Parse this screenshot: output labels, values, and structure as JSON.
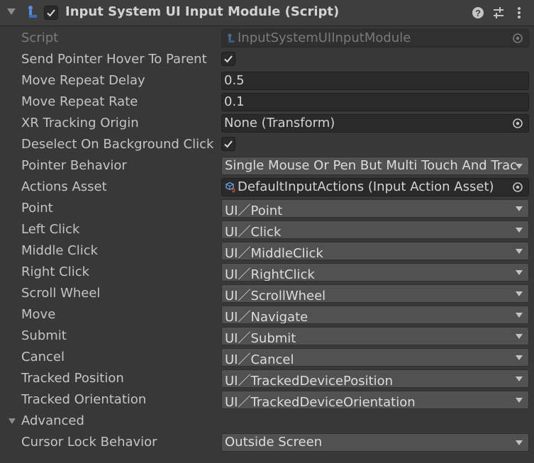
{
  "header": {
    "title": "Input System UI Input Module (Script)",
    "enabled": true,
    "icons": [
      "foldout-arrow-icon",
      "script-icon",
      "help-icon",
      "presets-icon",
      "more-options-icon"
    ]
  },
  "fields": {
    "script": {
      "label": "Script",
      "value": "InputSystemUIInputModule"
    },
    "send_pointer_hover": {
      "label": "Send Pointer Hover To Parent",
      "checked": true
    },
    "move_repeat_delay": {
      "label": "Move Repeat Delay",
      "value": "0.5"
    },
    "move_repeat_rate": {
      "label": "Move Repeat Rate",
      "value": "0.1"
    },
    "xr_tracking_origin": {
      "label": "XR Tracking Origin",
      "value": "None (Transform)"
    },
    "deselect_on_background_click": {
      "label": "Deselect On Background Click",
      "checked": true
    },
    "pointer_behavior": {
      "label": "Pointer Behavior",
      "value": "Single Mouse Or Pen But Multi Touch And Track"
    },
    "actions_asset": {
      "label": "Actions Asset",
      "value": "DefaultInputActions (Input Action Asset)"
    },
    "point": {
      "label": "Point",
      "value": "UI／Point"
    },
    "left_click": {
      "label": "Left Click",
      "value": "UI／Click"
    },
    "middle_click": {
      "label": "Middle Click",
      "value": "UI／MiddleClick"
    },
    "right_click": {
      "label": "Right Click",
      "value": "UI／RightClick"
    },
    "scroll_wheel": {
      "label": "Scroll Wheel",
      "value": "UI／ScrollWheel"
    },
    "move": {
      "label": "Move",
      "value": "UI／Navigate"
    },
    "submit": {
      "label": "Submit",
      "value": "UI／Submit"
    },
    "cancel": {
      "label": "Cancel",
      "value": "UI／Cancel"
    },
    "tracked_position": {
      "label": "Tracked Position",
      "value": "UI／TrackedDevicePosition"
    },
    "tracked_orientation": {
      "label": "Tracked Orientation",
      "value": "UI／TrackedDeviceOrientation"
    }
  },
  "advanced": {
    "label": "Advanced",
    "expanded": true,
    "cursor_lock_behavior": {
      "label": "Cursor Lock Behavior",
      "value": "Outside Screen"
    }
  },
  "colors": {
    "background": "#383838",
    "header": "#3e3e3e",
    "field": "#2a2a2a",
    "dropdown": "#515151",
    "text": "#c4c4c4",
    "asset_icon_accent": "#e05a3a"
  }
}
